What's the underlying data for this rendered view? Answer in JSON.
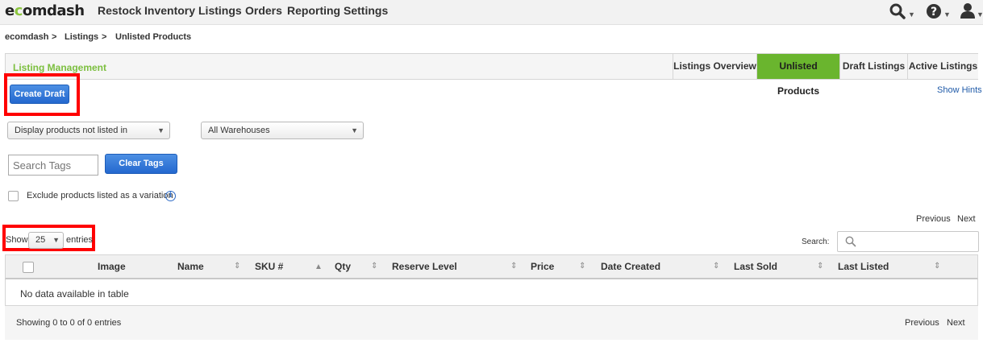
{
  "logo": {
    "pre": "e",
    "o": "c",
    "post": "omdash"
  },
  "nav": {
    "items": [
      "Restock",
      "Inventory",
      "Listings",
      "Orders",
      "Reporting",
      "Settings"
    ]
  },
  "icons": {
    "search": "search-icon",
    "help": "help-icon",
    "user": "user-icon"
  },
  "breadcrumb": [
    "ecomdash",
    "Listings",
    "Unlisted Products"
  ],
  "breadcrumb_sep": ">",
  "panel": {
    "title": "Listing Management",
    "tabs": [
      "Listings Overview",
      "Unlisted Products",
      "Draft Listings",
      "Active Listings"
    ],
    "active_tab": "Unlisted Products"
  },
  "actions": {
    "create_draft": "Create Draft",
    "show_hints": "Show Hints"
  },
  "filters": {
    "display_select": "Display products not listed in",
    "warehouse_select": "All Warehouses",
    "search_tags_placeholder": "Search Tags",
    "clear_tags": "Clear Tags",
    "exclude_variation": "Exclude products listed as a variation"
  },
  "pagination_top": {
    "previous": "Previous",
    "next": "Next"
  },
  "entries": {
    "show": "Show",
    "value": "25",
    "suffix": "entries"
  },
  "search_label": "Search:",
  "table": {
    "columns": [
      "Image",
      "Name",
      "SKU #",
      "Qty",
      "Reserve Level",
      "Price",
      "Date Created",
      "Last Sold",
      "Last Listed"
    ],
    "empty": "No data available in table"
  },
  "footer": {
    "info": "Showing 0 to 0 of 0 entries",
    "previous": "Previous",
    "next": "Next"
  },
  "colors": {
    "accent_green": "#6ab52e",
    "button_blue": "#2468cf",
    "highlight_red": "#ff0000"
  }
}
